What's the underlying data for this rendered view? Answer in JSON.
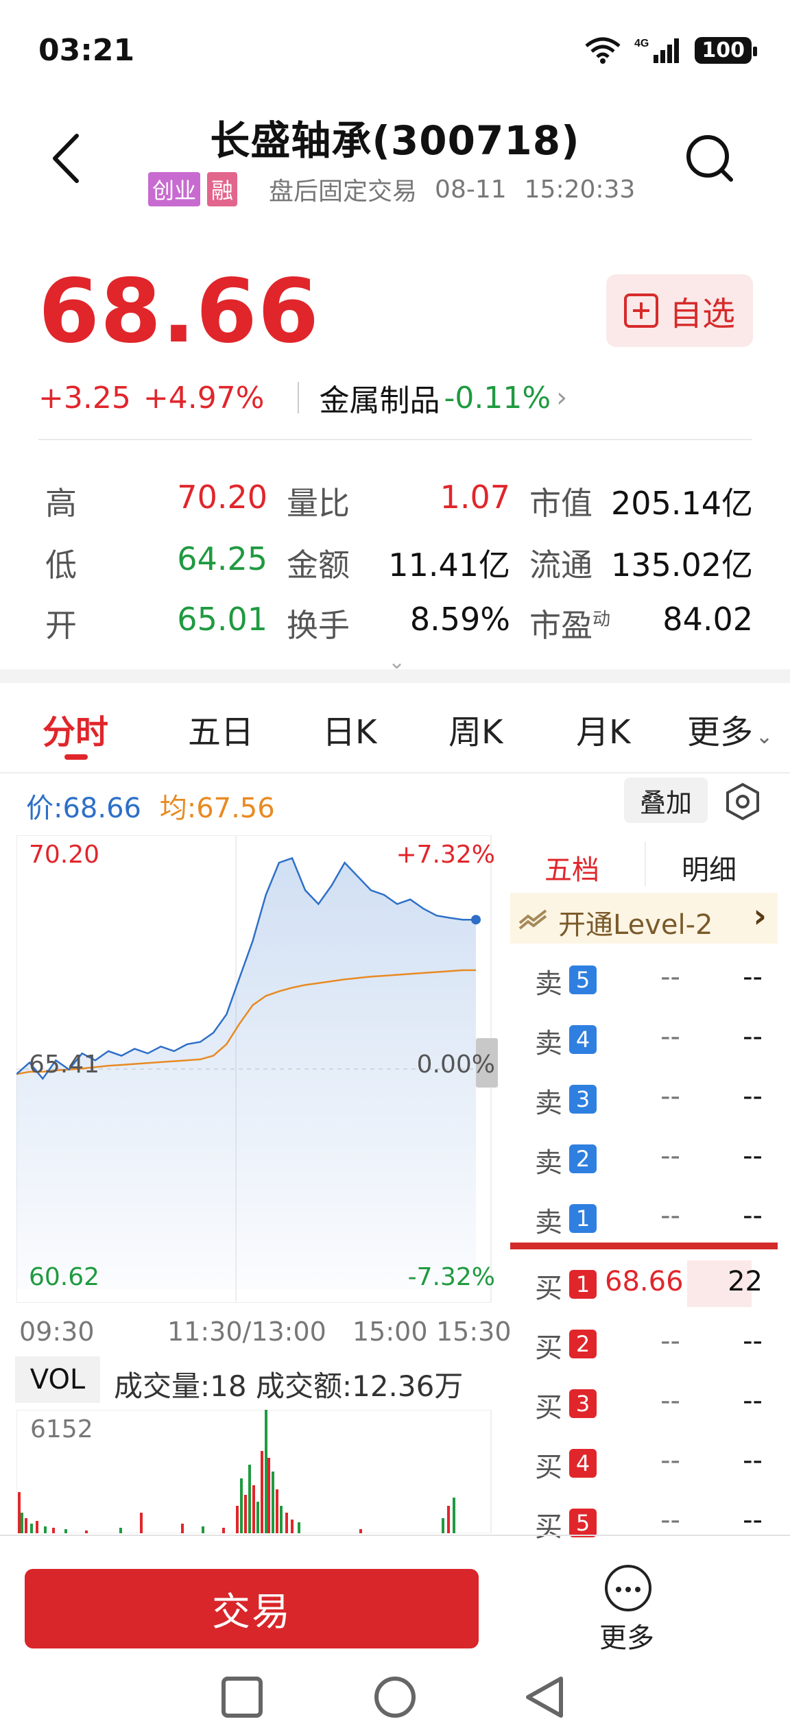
{
  "status_bar": {
    "time": "03:21",
    "network": "4G",
    "battery": "100"
  },
  "header": {
    "title": "长盛轴承(300718)",
    "tag_board": "创业",
    "tag_margin": "融",
    "trade_mode": "盘后固定交易",
    "date": "08-11",
    "clock": "15:20:33"
  },
  "quote": {
    "price": "68.66",
    "change": "+3.25",
    "change_pct": "+4.97%",
    "sector": "金属制品",
    "sector_pct": "-0.11%",
    "watch_label": "自选"
  },
  "stats": [
    {
      "label": "高",
      "value": "70.20",
      "color": "red"
    },
    {
      "label": "量比",
      "value": "1.07",
      "color": "red"
    },
    {
      "label": "市值",
      "value": "205.14亿",
      "color": "black"
    },
    {
      "label": "低",
      "value": "64.25",
      "color": "green"
    },
    {
      "label": "金额",
      "value": "11.41亿",
      "color": "black"
    },
    {
      "label": "流通",
      "value": "135.02亿",
      "color": "black"
    },
    {
      "label": "开",
      "value": "65.01",
      "color": "green"
    },
    {
      "label": "换手",
      "value": "8.59%",
      "color": "black"
    },
    {
      "label": "市盈",
      "label_sup": "动",
      "value": "84.02",
      "color": "black"
    }
  ],
  "tabs": [
    "分时",
    "五日",
    "日K",
    "周K",
    "月K",
    "更多"
  ],
  "active_tab": "分时",
  "chart_bar": {
    "price_label": "价:68.66",
    "avg_label": "均:67.56",
    "overlay_button": "叠加"
  },
  "chart_data": {
    "type": "line",
    "y_labels": {
      "top": "70.20",
      "mid": "65.41",
      "bottom": "60.62"
    },
    "pct_labels": {
      "top": "+7.32%",
      "mid": "0.00%",
      "bottom": "-7.32%"
    },
    "x_labels": [
      "09:30",
      "11:30/13:00",
      "15:00",
      "15:30"
    ],
    "ylim": [
      60.62,
      70.2
    ],
    "series": [
      {
        "name": "价",
        "values": [
          65.3,
          65.55,
          65.2,
          65.6,
          65.4,
          65.75,
          65.6,
          65.8,
          65.7,
          65.85,
          65.75,
          65.9,
          65.8,
          65.95,
          66.0,
          66.2,
          66.6,
          67.4,
          68.2,
          69.2,
          69.9,
          70.0,
          69.3,
          69.0,
          69.4,
          69.9,
          69.6,
          69.3,
          69.2,
          69.0,
          69.1,
          68.9,
          68.75,
          68.7,
          68.66,
          68.66
        ]
      },
      {
        "name": "均",
        "values": [
          65.3,
          65.35,
          65.35,
          65.38,
          65.4,
          65.42,
          65.45,
          65.48,
          65.5,
          65.52,
          65.54,
          65.56,
          65.58,
          65.6,
          65.62,
          65.7,
          65.95,
          66.4,
          66.8,
          67.0,
          67.1,
          67.18,
          67.24,
          67.28,
          67.32,
          67.36,
          67.39,
          67.42,
          67.44,
          67.46,
          67.48,
          67.5,
          67.52,
          67.54,
          67.56,
          67.56
        ]
      }
    ]
  },
  "order_book": {
    "tabs": [
      "五档",
      "明细"
    ],
    "level2_label": "开通Level-2",
    "asks": [
      {
        "side": "卖",
        "n": "5",
        "price": "--",
        "vol": "--"
      },
      {
        "side": "卖",
        "n": "4",
        "price": "--",
        "vol": "--"
      },
      {
        "side": "卖",
        "n": "3",
        "price": "--",
        "vol": "--"
      },
      {
        "side": "卖",
        "n": "2",
        "price": "--",
        "vol": "--"
      },
      {
        "side": "卖",
        "n": "1",
        "price": "--",
        "vol": "--"
      }
    ],
    "bids": [
      {
        "side": "买",
        "n": "1",
        "price": "68.66",
        "vol": "22"
      },
      {
        "side": "买",
        "n": "2",
        "price": "--",
        "vol": "--"
      },
      {
        "side": "买",
        "n": "3",
        "price": "--",
        "vol": "--"
      },
      {
        "side": "买",
        "n": "4",
        "price": "--",
        "vol": "--"
      },
      {
        "side": "买",
        "n": "5",
        "price": "--",
        "vol": "--"
      }
    ]
  },
  "volume": {
    "tag": "VOL",
    "summary": "成交量:18 成交额:12.36万",
    "max_label": "6152"
  },
  "bottom": {
    "trade_label": "交易",
    "more_label": "更多"
  },
  "colors": {
    "up": "#e0262b",
    "down": "#1f9a40",
    "price_line": "#2d6fc8",
    "avg_line": "#e88a22",
    "accent": "#d8262a"
  }
}
